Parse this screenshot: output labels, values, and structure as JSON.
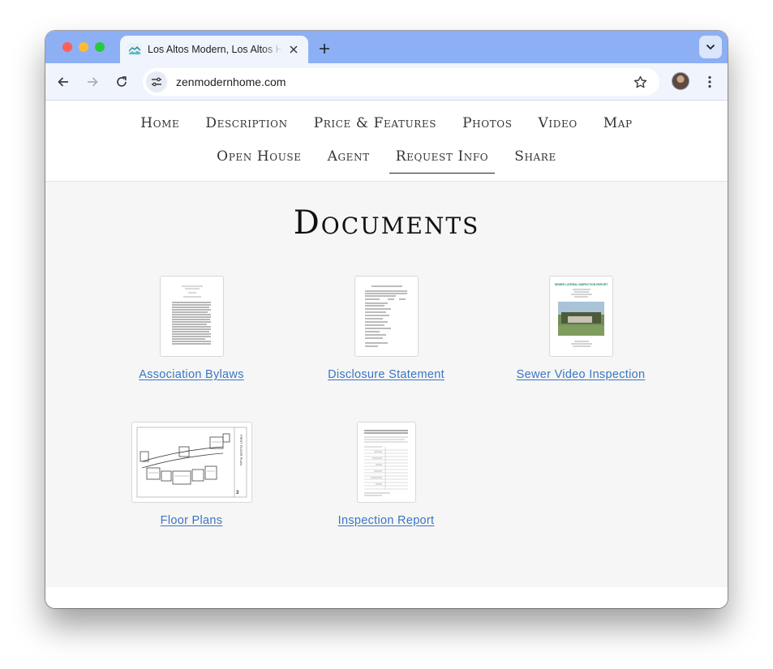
{
  "browser": {
    "tab_title": "Los Altos Modern, Los Altos Hills",
    "url": "zenmodernhome.com"
  },
  "nav": {
    "row1": [
      "Home",
      "Description",
      "Price & Features",
      "Photos",
      "Video",
      "Map"
    ],
    "row2": [
      "Open House",
      "Agent",
      "Request Info",
      "Share"
    ],
    "active": "Request Info"
  },
  "main": {
    "heading": "Documents",
    "documents": [
      {
        "label": "Association Bylaws",
        "thumb": "text-page"
      },
      {
        "label": "Disclosure Statement",
        "thumb": "form-page"
      },
      {
        "label": "Sewer Video Inspection",
        "thumb": "photo-report",
        "thumb_title": "SEWER LATERAL INSPECTION REPORT"
      },
      {
        "label": "Floor Plans",
        "thumb": "floor-plan",
        "thumb_side_text": "FIRST FLOOR PLAN"
      },
      {
        "label": "Inspection Report",
        "thumb": "table-page"
      }
    ]
  },
  "colors": {
    "tabstrip": "#8db0f4",
    "toolbar": "#f0f4fd",
    "link": "#3a75c4",
    "content_bg": "#f6f6f6"
  }
}
